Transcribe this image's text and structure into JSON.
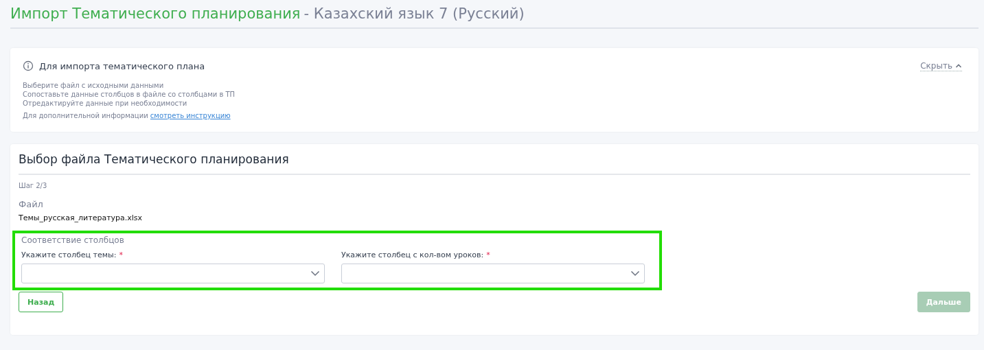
{
  "header": {
    "title": "Импорт Тематического планирования",
    "subtitle": "- Казахский язык 7 (Русский)"
  },
  "info": {
    "title": "Для импорта тематического плана",
    "toggle": "Скрыть",
    "expanded": true,
    "lines": [
      "Выберите файл с исходными данными",
      "Сопоставьте данные столбцов в файле со столбцами в ТП",
      "Отредактируйте данные при необходимости"
    ],
    "more_text": "Для дополнительной информации",
    "link": "смотреть инструкцию"
  },
  "step_card": {
    "title": "Выбор файла Тематического планирования",
    "step": "Шаг 2/3",
    "file_label": "Файл",
    "file_name": "Темы_русская_литература.xlsx",
    "mapping": {
      "title": "Соответствие столбцов",
      "highlighted": true,
      "fields": [
        {
          "label": "Укажите столбец темы:",
          "required_mark": "*"
        },
        {
          "label": "Укажите столбец с кол-вом уроков:",
          "required_mark": "*"
        }
      ]
    },
    "buttons": [
      {
        "label": "Назад",
        "kind": "secondary",
        "disabled": false
      },
      {
        "label": "Дальше",
        "kind": "primary",
        "disabled": true
      }
    ]
  }
}
